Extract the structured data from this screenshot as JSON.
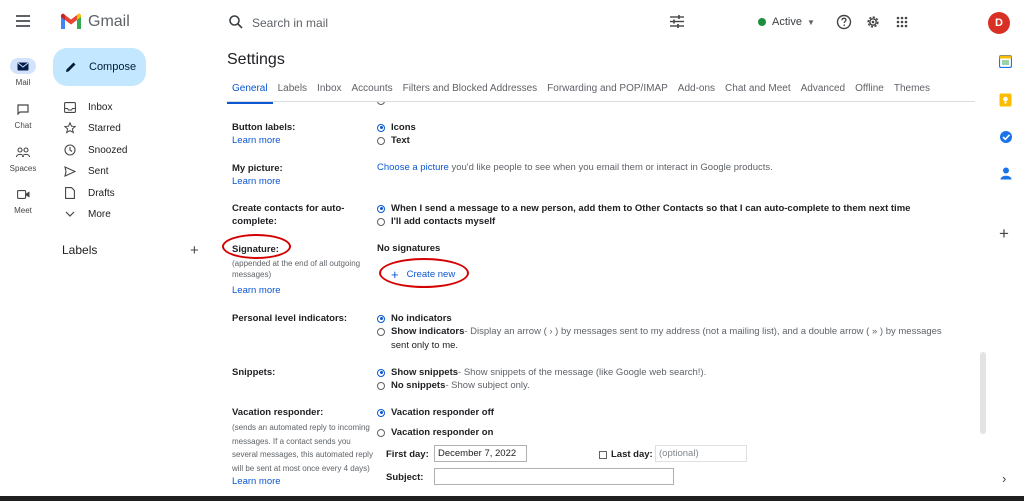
{
  "header": {
    "app_name": "Gmail",
    "search_placeholder": "Search in mail",
    "status_label": "Active",
    "avatar_initial": "D",
    "accent": "#0b57d0"
  },
  "rail": {
    "items": [
      {
        "label": "Mail",
        "icon": "mail-icon",
        "active": true
      },
      {
        "label": "Chat",
        "icon": "chat-icon"
      },
      {
        "label": "Spaces",
        "icon": "spaces-icon"
      },
      {
        "label": "Meet",
        "icon": "meet-icon"
      }
    ]
  },
  "nav": {
    "compose_label": "Compose",
    "items": [
      {
        "label": "Inbox",
        "icon": "inbox-icon"
      },
      {
        "label": "Starred",
        "icon": "star-icon"
      },
      {
        "label": "Snoozed",
        "icon": "clock-icon"
      },
      {
        "label": "Sent",
        "icon": "send-icon"
      },
      {
        "label": "Drafts",
        "icon": "draft-icon"
      },
      {
        "label": "More",
        "icon": "chevron-down-icon"
      }
    ],
    "labels_title": "Labels",
    "labels_add": "+"
  },
  "settings": {
    "title": "Settings",
    "tabs": [
      "General",
      "Labels",
      "Inbox",
      "Accounts",
      "Filters and Blocked Addresses",
      "Forwarding and POP/IMAP",
      "Add-ons",
      "Chat and Meet",
      "Advanced",
      "Offline",
      "Themes"
    ],
    "active_tab": "General",
    "learn_more": "Learn more",
    "button_labels": {
      "label": "Button labels:",
      "options": [
        "Icons",
        "Text"
      ],
      "selected": "Icons"
    },
    "my_picture": {
      "label": "My picture:",
      "link": "Choose a picture",
      "text": " you'd like people to see when you email them or interact in Google products."
    },
    "create_contacts": {
      "label": "Create contacts for auto-complete:",
      "options": [
        "When I send a message to a new person, add them to Other Contacts so that I can auto-complete to them next time",
        "I'll add contacts myself"
      ],
      "selected": 0
    },
    "signature": {
      "label": "Signature:",
      "sub": "(appended at the end of all outgoing messages)",
      "value": "No signatures",
      "create_new": "Create new",
      "highlight_color": "#d50000"
    },
    "personal_level": {
      "label": "Personal level indicators:",
      "opt1": "No indicators",
      "opt2_bold": "Show indicators",
      "opt2_text": " - Display an arrow ( › ) by messages sent to my address (not a mailing list), and a double arrow ( » ) by messages",
      "opt2_cont": "sent only to me."
    },
    "snippets": {
      "label": "Snippets:",
      "opt1_bold": "Show snippets",
      "opt1_text": " - Show snippets of the message (like Google web search!).",
      "opt2_bold": "No snippets",
      "opt2_text": " - Show subject only."
    },
    "vacation": {
      "label": "Vacation responder:",
      "sub": "(sends an automated reply to incoming messages. If a contact sends you several messages, this automated reply will be sent at most once every 4 days)",
      "opt1": "Vacation responder off",
      "opt2": "Vacation responder on",
      "first_day_label": "First day:",
      "first_day_value": "December 7, 2022",
      "last_day_label": "Last day:",
      "last_day_placeholder": "(optional)",
      "subject_label": "Subject:"
    }
  }
}
